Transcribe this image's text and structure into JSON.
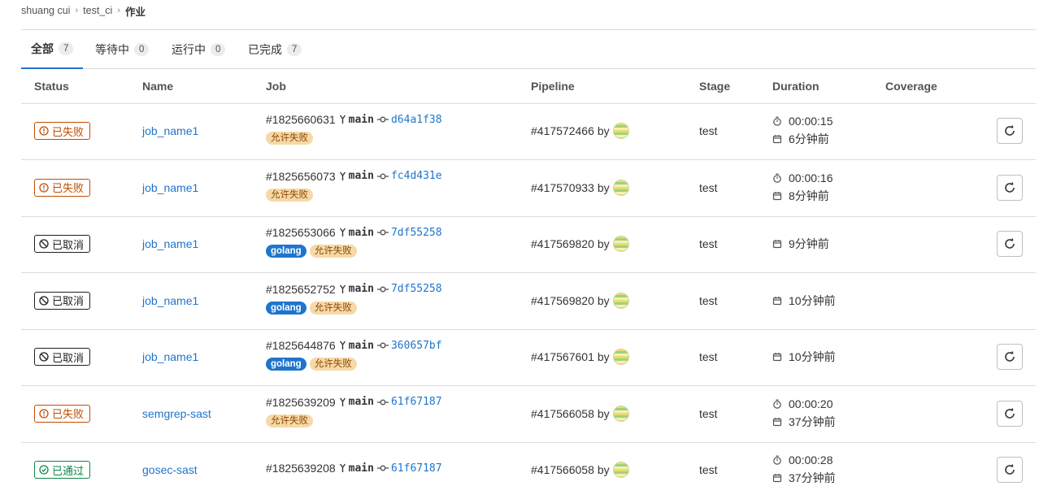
{
  "breadcrumb": [
    "shuang cui",
    "test_ci",
    "作业"
  ],
  "tabs": [
    {
      "label": "全部",
      "count": "7"
    },
    {
      "label": "等待中",
      "count": "0"
    },
    {
      "label": "运行中",
      "count": "0"
    },
    {
      "label": "已完成",
      "count": "7"
    }
  ],
  "columns": {
    "status": "Status",
    "name": "Name",
    "job": "Job",
    "pipeline": "Pipeline",
    "stage": "Stage",
    "duration": "Duration",
    "coverage": "Coverage"
  },
  "pipeline_by": "by",
  "rows": [
    {
      "status": "已失败",
      "name": "job_name1",
      "job_id": "#1825660631",
      "ref": "main",
      "sha": "d64a1f38",
      "tags": [
        "允许失败"
      ],
      "pipeline": "#417572466",
      "stage": "test",
      "duration": "00:00:15",
      "finished": "6分钟前"
    },
    {
      "status": "已失败",
      "name": "job_name1",
      "job_id": "#1825656073",
      "ref": "main",
      "sha": "fc4d431e",
      "tags": [
        "允许失败"
      ],
      "pipeline": "#417570933",
      "stage": "test",
      "duration": "00:00:16",
      "finished": "8分钟前"
    },
    {
      "status": "已取消",
      "name": "job_name1",
      "job_id": "#1825653066",
      "ref": "main",
      "sha": "7df55258",
      "tags": [
        "golang",
        "允许失败"
      ],
      "pipeline": "#417569820",
      "stage": "test",
      "finished": "9分钟前"
    },
    {
      "status": "已取消",
      "name": "job_name1",
      "job_id": "#1825652752",
      "ref": "main",
      "sha": "7df55258",
      "tags": [
        "golang",
        "允许失败"
      ],
      "pipeline": "#417569820",
      "stage": "test",
      "finished": "10分钟前"
    },
    {
      "status": "已取消",
      "name": "job_name1",
      "job_id": "#1825644876",
      "ref": "main",
      "sha": "360657bf",
      "tags": [
        "golang",
        "允许失败"
      ],
      "pipeline": "#417567601",
      "stage": "test",
      "finished": "10分钟前"
    },
    {
      "status": "已失败",
      "name": "semgrep-sast",
      "job_id": "#1825639209",
      "ref": "main",
      "sha": "61f67187",
      "tags": [
        "允许失败"
      ],
      "pipeline": "#417566058",
      "stage": "test",
      "duration": "00:00:20",
      "finished": "37分钟前"
    },
    {
      "status": "已通过",
      "name": "gosec-sast",
      "job_id": "#1825639208",
      "ref": "main",
      "sha": "61f67187",
      "tags": [],
      "pipeline": "#417566058",
      "stage": "test",
      "duration": "00:00:28",
      "finished": "37分钟前"
    }
  ],
  "colors": {
    "link": "#1f75cb",
    "failed": "#c24d00",
    "canceled": "#1f1e24",
    "passed": "#108548",
    "border": "#dcdcde"
  },
  "icons": {
    "failed": "status-failed-icon",
    "canceled": "status-canceled-icon",
    "passed": "status-success-icon",
    "branch": "branch-icon",
    "commit": "commit-icon",
    "duration": "timer-icon",
    "finished": "calendar-icon",
    "retry": "retry-icon"
  }
}
